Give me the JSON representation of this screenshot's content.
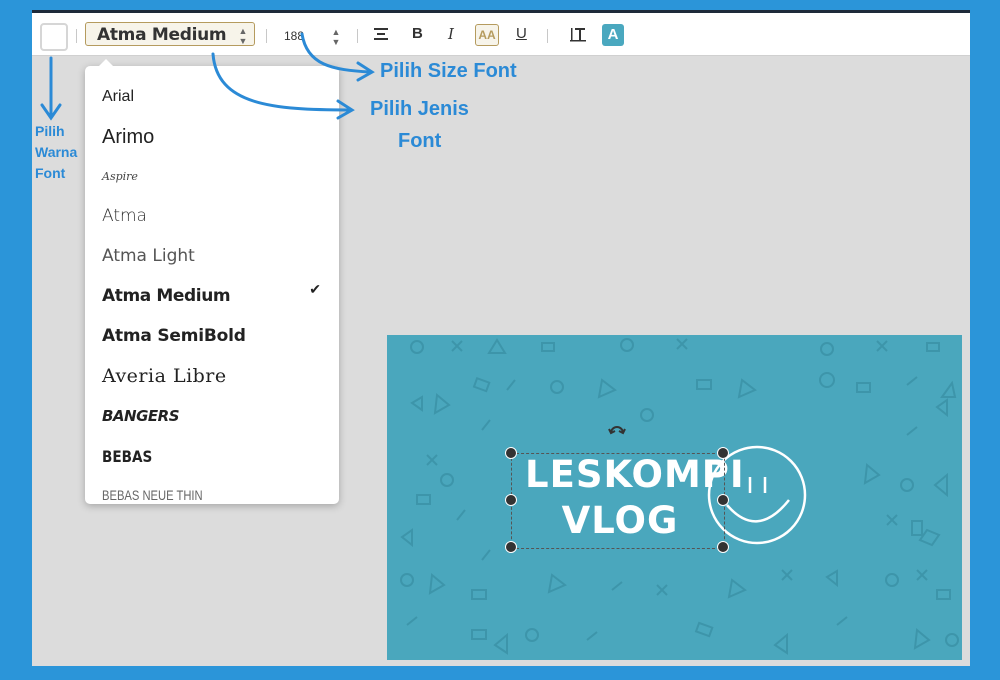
{
  "toolbar": {
    "font_select": "Atma Medium",
    "font_size": "188",
    "align_icon": "align-center-icon",
    "bold_label": "B",
    "italic_label": "I",
    "uppercase_label": "AA",
    "underline_label": "U",
    "line_height_icon": "line-height-icon",
    "text_bg_label": "A",
    "spinner_arrows": "▲▼"
  },
  "font_dropdown": {
    "options": [
      {
        "label": "Arial"
      },
      {
        "label": "Arimo"
      },
      {
        "label": "Aspire"
      },
      {
        "label": "Atma"
      },
      {
        "label": "Atma Light"
      },
      {
        "label": "Atma Medium",
        "selected": true
      },
      {
        "label": "Atma SemiBold"
      },
      {
        "label": "Averia Libre"
      },
      {
        "label": "BANGERS"
      },
      {
        "label": "BEBAS"
      },
      {
        "label": "BEBAS NEUE THIN"
      }
    ],
    "check_mark": "✔"
  },
  "canvas": {
    "logo_line1": "LESKOMPI",
    "logo_line2": "VLOG",
    "background_color": "#4aa7bd"
  },
  "annotations": {
    "size_font": "Pilih Size Font",
    "jenis_font_line1": "Pilih Jenis",
    "jenis_font_line2": "Font",
    "warna_line1": "Pilih",
    "warna_line2": "Warna",
    "warna_line3": "Font",
    "color": "#2b8ad6"
  }
}
